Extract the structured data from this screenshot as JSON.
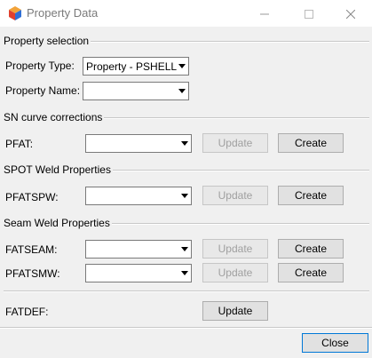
{
  "window": {
    "title": "Property Data",
    "minimize_icon": "minimize-icon",
    "maximize_icon": "maximize-icon",
    "close_icon": "close-icon"
  },
  "property_selection": {
    "heading": "Property selection",
    "type_label": "Property Type:",
    "type_value": "Property - PSHELL",
    "name_label": "Property Name:",
    "name_value": ""
  },
  "sn_curve": {
    "heading": "SN curve corrections",
    "pfat_label": "PFAT:",
    "pfat_value": "",
    "update_label": "Update",
    "create_label": "Create"
  },
  "spot_weld": {
    "heading": "SPOT Weld Properties",
    "pfatspw_label": "PFATSPW:",
    "pfatspw_value": "",
    "update_label": "Update",
    "create_label": "Create"
  },
  "seam_weld": {
    "heading": "Seam Weld Properties",
    "fatseam_label": "FATSEAM:",
    "fatseam_value": "",
    "fatseam_update": "Update",
    "fatseam_create": "Create",
    "pfatsmw_label": "PFATSMW:",
    "pfatsmw_value": "",
    "pfatsmw_update": "Update",
    "pfatsmw_create": "Create"
  },
  "fatdef": {
    "label": "FATDEF:",
    "update_label": "Update"
  },
  "footer": {
    "close_label": "Close"
  }
}
